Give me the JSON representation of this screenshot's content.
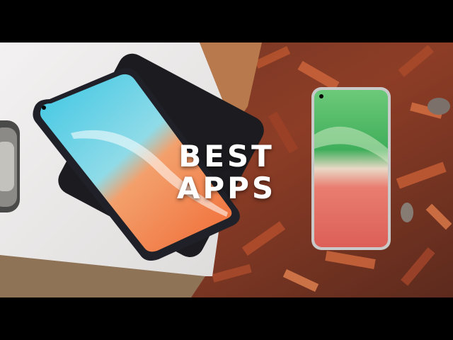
{
  "headline": {
    "line1": "BEST",
    "line2": "APPS"
  },
  "colors": {
    "letterbox": "#000000",
    "left_surface": "#ECEAEA",
    "wood_mulch": "#8A3B22",
    "phone_left_blue": "#3FC0DA",
    "phone_left_orange": "#F07A3E",
    "phone_right_green": "#4DB865",
    "phone_right_red": "#E26A5E",
    "headline_text": "#FFFFFF"
  }
}
